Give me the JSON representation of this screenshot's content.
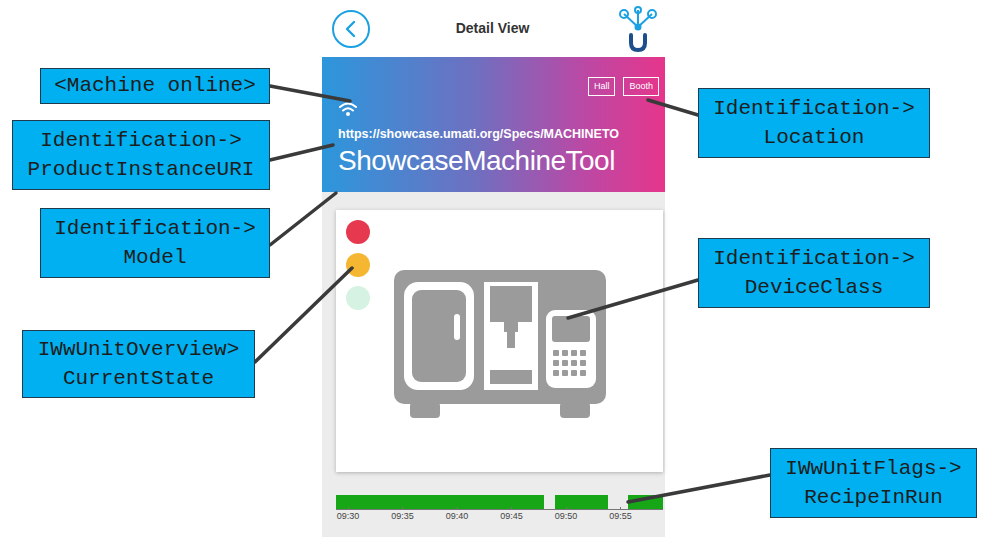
{
  "header": {
    "title": "Detail View"
  },
  "banner": {
    "online": true,
    "location": [
      {
        "label": "Hall"
      },
      {
        "label": "Booth"
      }
    ],
    "product_instance_uri": "https://showcase.umati.org/Specs/MACHINETO",
    "model": "ShowcaseMachineTool"
  },
  "status_lights": [
    {
      "color": "#e63950",
      "on": true
    },
    {
      "color": "#f5b731",
      "on": true
    },
    {
      "color": "#2dbd6e",
      "on": false
    }
  ],
  "timeline": {
    "axis": {
      "min": 28.9,
      "max": 58.9
    },
    "ticks": [
      {
        "label": "09:30",
        "value": 30
      },
      {
        "label": "09:35",
        "value": 35
      },
      {
        "label": "09:40",
        "value": 40
      },
      {
        "label": "09:45",
        "value": 45
      },
      {
        "label": "09:50",
        "value": 50
      },
      {
        "label": "09:55",
        "value": 55
      }
    ],
    "bars": [
      {
        "start": 28.9,
        "end": 48.0
      },
      {
        "start": 49.0,
        "end": 53.9
      },
      {
        "start": 55.7,
        "end": 58.9
      }
    ]
  },
  "callouts": [
    {
      "lines": [
        "<Machine online>"
      ]
    },
    {
      "lines": [
        "Identification->",
        "ProductInstanceURI"
      ]
    },
    {
      "lines": [
        "Identification->",
        "Model"
      ]
    },
    {
      "lines": [
        "IWwUnitOverview>",
        "CurrentState"
      ]
    },
    {
      "lines": [
        "Identification->",
        "Location"
      ]
    },
    {
      "lines": [
        "Identification->",
        "DeviceClass"
      ]
    },
    {
      "lines": [
        "IWwUnitFlags->",
        "RecipeInRun"
      ]
    }
  ]
}
